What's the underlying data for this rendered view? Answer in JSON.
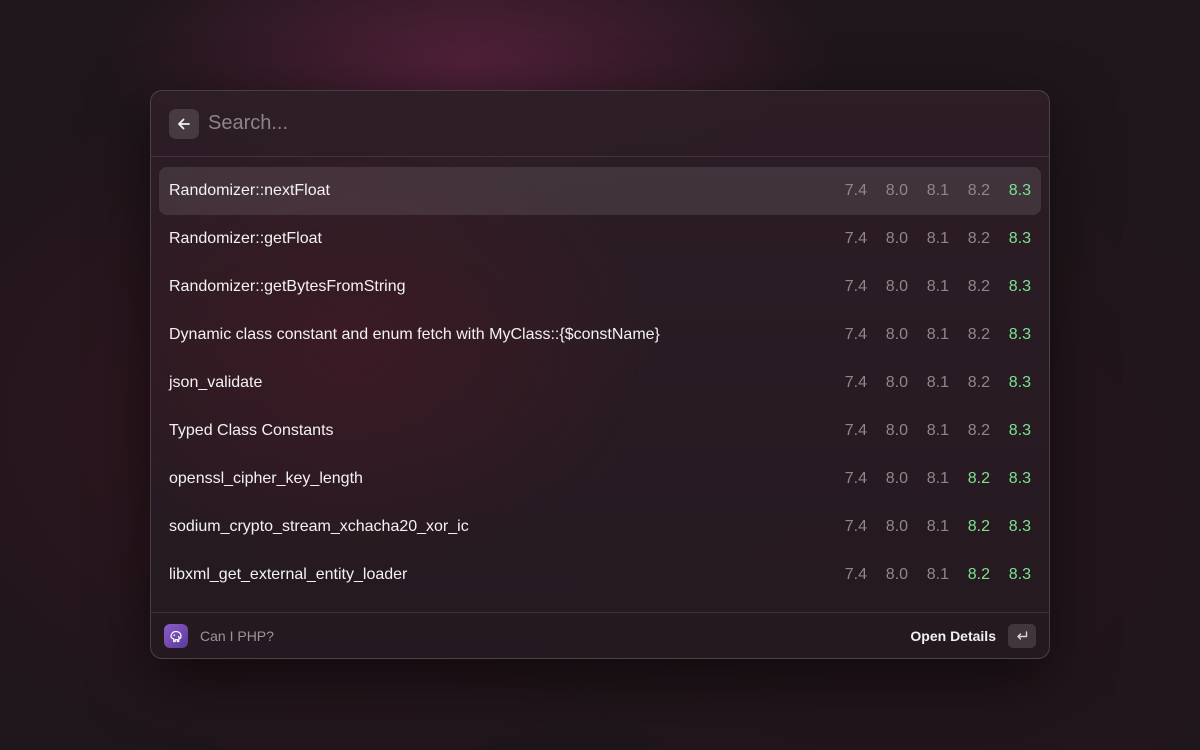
{
  "search": {
    "placeholder": "Search...",
    "value": ""
  },
  "items": [
    {
      "title": "Randomizer::nextFloat",
      "selected": true,
      "versions": [
        {
          "label": "7.4",
          "supported": false
        },
        {
          "label": "8.0",
          "supported": false
        },
        {
          "label": "8.1",
          "supported": false
        },
        {
          "label": "8.2",
          "supported": false
        },
        {
          "label": "8.3",
          "supported": true
        }
      ]
    },
    {
      "title": "Randomizer::getFloat",
      "selected": false,
      "versions": [
        {
          "label": "7.4",
          "supported": false
        },
        {
          "label": "8.0",
          "supported": false
        },
        {
          "label": "8.1",
          "supported": false
        },
        {
          "label": "8.2",
          "supported": false
        },
        {
          "label": "8.3",
          "supported": true
        }
      ]
    },
    {
      "title": "Randomizer::getBytesFromString",
      "selected": false,
      "versions": [
        {
          "label": "7.4",
          "supported": false
        },
        {
          "label": "8.0",
          "supported": false
        },
        {
          "label": "8.1",
          "supported": false
        },
        {
          "label": "8.2",
          "supported": false
        },
        {
          "label": "8.3",
          "supported": true
        }
      ]
    },
    {
      "title": "Dynamic class constant and enum fetch with MyClass::{$constName}",
      "selected": false,
      "versions": [
        {
          "label": "7.4",
          "supported": false
        },
        {
          "label": "8.0",
          "supported": false
        },
        {
          "label": "8.1",
          "supported": false
        },
        {
          "label": "8.2",
          "supported": false
        },
        {
          "label": "8.3",
          "supported": true
        }
      ]
    },
    {
      "title": "json_validate",
      "selected": false,
      "versions": [
        {
          "label": "7.4",
          "supported": false
        },
        {
          "label": "8.0",
          "supported": false
        },
        {
          "label": "8.1",
          "supported": false
        },
        {
          "label": "8.2",
          "supported": false
        },
        {
          "label": "8.3",
          "supported": true
        }
      ]
    },
    {
      "title": "Typed Class Constants",
      "selected": false,
      "versions": [
        {
          "label": "7.4",
          "supported": false
        },
        {
          "label": "8.0",
          "supported": false
        },
        {
          "label": "8.1",
          "supported": false
        },
        {
          "label": "8.2",
          "supported": false
        },
        {
          "label": "8.3",
          "supported": true
        }
      ]
    },
    {
      "title": "openssl_cipher_key_length",
      "selected": false,
      "versions": [
        {
          "label": "7.4",
          "supported": false
        },
        {
          "label": "8.0",
          "supported": false
        },
        {
          "label": "8.1",
          "supported": false
        },
        {
          "label": "8.2",
          "supported": true
        },
        {
          "label": "8.3",
          "supported": true
        }
      ]
    },
    {
      "title": "sodium_crypto_stream_xchacha20_xor_ic",
      "selected": false,
      "versions": [
        {
          "label": "7.4",
          "supported": false
        },
        {
          "label": "8.0",
          "supported": false
        },
        {
          "label": "8.1",
          "supported": false
        },
        {
          "label": "8.2",
          "supported": true
        },
        {
          "label": "8.3",
          "supported": true
        }
      ]
    },
    {
      "title": "libxml_get_external_entity_loader",
      "selected": false,
      "versions": [
        {
          "label": "7.4",
          "supported": false
        },
        {
          "label": "8.0",
          "supported": false
        },
        {
          "label": "8.1",
          "supported": false
        },
        {
          "label": "8.2",
          "supported": true
        },
        {
          "label": "8.3",
          "supported": true
        }
      ]
    }
  ],
  "footer": {
    "app_name": "Can I PHP?",
    "action_label": "Open Details"
  },
  "icons": {
    "back": "arrow-left-icon",
    "app": "php-elephant-icon",
    "enter": "return-key-icon"
  },
  "colors": {
    "supported": "#7ee08f",
    "unsupported": "#8f878b"
  }
}
